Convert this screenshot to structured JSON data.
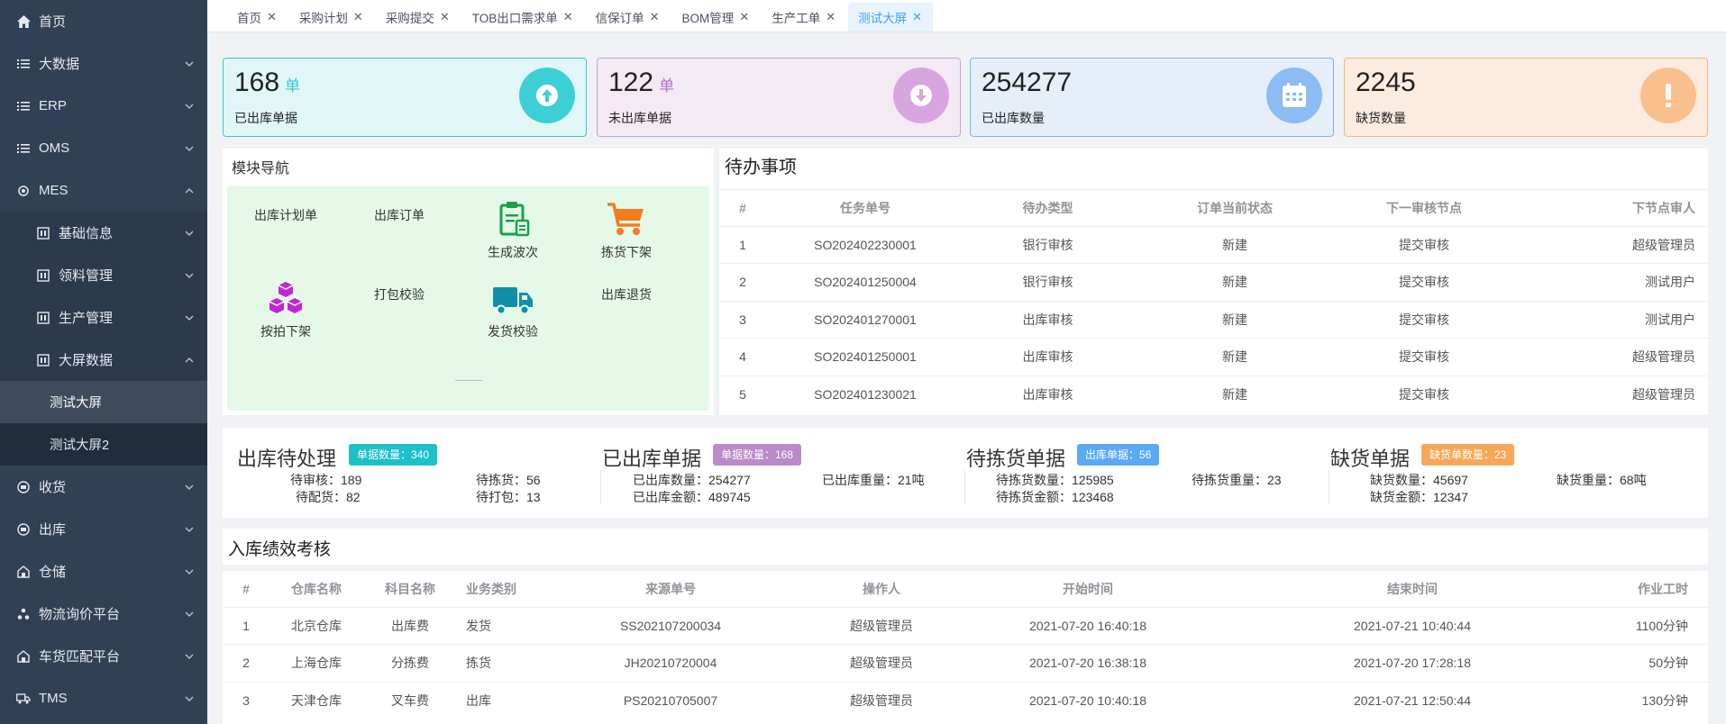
{
  "sidebar": {
    "items": [
      {
        "label": "首页",
        "icon": "home-icon"
      },
      {
        "label": "大数据",
        "icon": "list-icon"
      },
      {
        "label": "ERP",
        "icon": "list-icon"
      },
      {
        "label": "OMS",
        "icon": "list-icon"
      },
      {
        "label": "MES",
        "icon": "gear-icon"
      },
      {
        "label": "基础信息",
        "icon": "panel-icon"
      },
      {
        "label": "领料管理",
        "icon": "panel-icon"
      },
      {
        "label": "生产管理",
        "icon": "panel-icon"
      },
      {
        "label": "大屏数据",
        "icon": "panel-icon"
      },
      {
        "label": "测试大屏"
      },
      {
        "label": "测试大屏2"
      },
      {
        "label": "收货",
        "icon": "inbox-icon"
      },
      {
        "label": "出库",
        "icon": "inbox-icon"
      },
      {
        "label": "仓储",
        "icon": "warehouse-icon"
      },
      {
        "label": "物流询价平台",
        "icon": "network-icon"
      },
      {
        "label": "车货匹配平台",
        "icon": "warehouse-icon"
      },
      {
        "label": "TMS",
        "icon": "truck-icon"
      }
    ]
  },
  "tabs": [
    {
      "label": "首页"
    },
    {
      "label": "采购计划"
    },
    {
      "label": "采购提交"
    },
    {
      "label": "TOB出口需求单"
    },
    {
      "label": "信保订单"
    },
    {
      "label": "BOM管理"
    },
    {
      "label": "生产工单"
    },
    {
      "label": "测试大屏"
    }
  ],
  "stats": [
    {
      "value": "168",
      "unit": "单",
      "label": "已出库单据",
      "bg": "#e1f6f7",
      "border": "#36c6d3",
      "circle": "#3ccfd6",
      "unitColor": "#36c6d3",
      "icon": "arrow-up-icon"
    },
    {
      "value": "122",
      "unit": "单",
      "label": "未出库单据",
      "bg": "#f4eaf4",
      "border": "#c8a2d8",
      "circle": "#d9a5e0",
      "unitColor": "#b071c9",
      "icon": "arrow-down-icon"
    },
    {
      "value": "254277",
      "unit": "",
      "label": "已出库数量",
      "bg": "#e6eef9",
      "border": "#7fb0ee",
      "circle": "#8bbcf4",
      "unitColor": "#409eff",
      "icon": "calendar-icon"
    },
    {
      "value": "2245",
      "unit": "",
      "label": "缺货数量",
      "bg": "#fcebdf",
      "border": "#f5b37a",
      "circle": "#f9c08e",
      "unitColor": "#f39c42",
      "icon": "exclamation-icon"
    }
  ],
  "module_nav": {
    "title": "模块导航",
    "items": [
      "出库计划单",
      "出库订单",
      "生成波次",
      "拣货下架",
      "按拍下架",
      "打包校验",
      "发货校验",
      "出库退货"
    ]
  },
  "todo": {
    "title": "待办事项",
    "headers": [
      "#",
      "任务单号",
      "待办类型",
      "订单当前状态",
      "下一审核节点",
      "下节点审人"
    ],
    "rows": [
      [
        "1",
        "SO202402230001",
        "银行审核",
        "新建",
        "提交审核",
        "超级管理员"
      ],
      [
        "2",
        "SO202401250004",
        "银行审核",
        "新建",
        "提交审核",
        "测试用户"
      ],
      [
        "3",
        "SO202401270001",
        "出库审核",
        "新建",
        "提交审核",
        "测试用户"
      ],
      [
        "4",
        "SO202401250001",
        "出库审核",
        "新建",
        "提交审核",
        "超级管理员"
      ],
      [
        "5",
        "SO202401230021",
        "出库审核",
        "新建",
        "提交审核",
        "超级管理员"
      ]
    ]
  },
  "summary": [
    {
      "title": "出库待处理",
      "badge": "单据数量：340",
      "badgeColor": "#1ec0c8",
      "left": [
        "待审核：189",
        "待配货：82"
      ],
      "right": [
        "待拣货：56",
        "待打包：13"
      ]
    },
    {
      "title": "已出库单据",
      "badge": "单据数量：168",
      "badgeColor": "#b98bc9",
      "left": [
        "已出库数量：254277",
        "已出库金额：489745"
      ],
      "right": [
        "已出库重量：21吨"
      ]
    },
    {
      "title": "待拣货单据",
      "badge": "出库单据：56",
      "badgeColor": "#5aa9f5",
      "left": [
        "待拣货数量：125985",
        "待拣货金额：123468"
      ],
      "right": [
        "待拣货重量：23"
      ]
    },
    {
      "title": "缺货单据",
      "badge": "缺货单数量：23",
      "badgeColor": "#f5a85a",
      "left": [
        "缺货数量：45697",
        "缺货金额：12347"
      ],
      "right": [
        "缺货重量：68吨"
      ]
    }
  ],
  "performance": {
    "title": "入库绩效考核",
    "headers": [
      "#",
      "仓库名称",
      "科目名称",
      "业务类别",
      "来源单号",
      "操作人",
      "开始时间",
      "结束时间",
      "作业工时"
    ],
    "rows": [
      [
        "1",
        "北京仓库",
        "出库费",
        "发货",
        "SS202107200034",
        "超级管理员",
        "2021-07-20 16:40:18",
        "2021-07-21 10:40:44",
        "1100分钟"
      ],
      [
        "2",
        "上海仓库",
        "分拣费",
        "拣货",
        "JH20210720004",
        "超级管理员",
        "2021-07-20 16:38:18",
        "2021-07-20 17:28:18",
        "50分钟"
      ],
      [
        "3",
        "天津仓库",
        "叉车费",
        "出库",
        "PS20210705007",
        "超级管理员",
        "2021-07-20 10:40:18",
        "2021-07-21 12:50:44",
        "130分钟"
      ]
    ]
  }
}
